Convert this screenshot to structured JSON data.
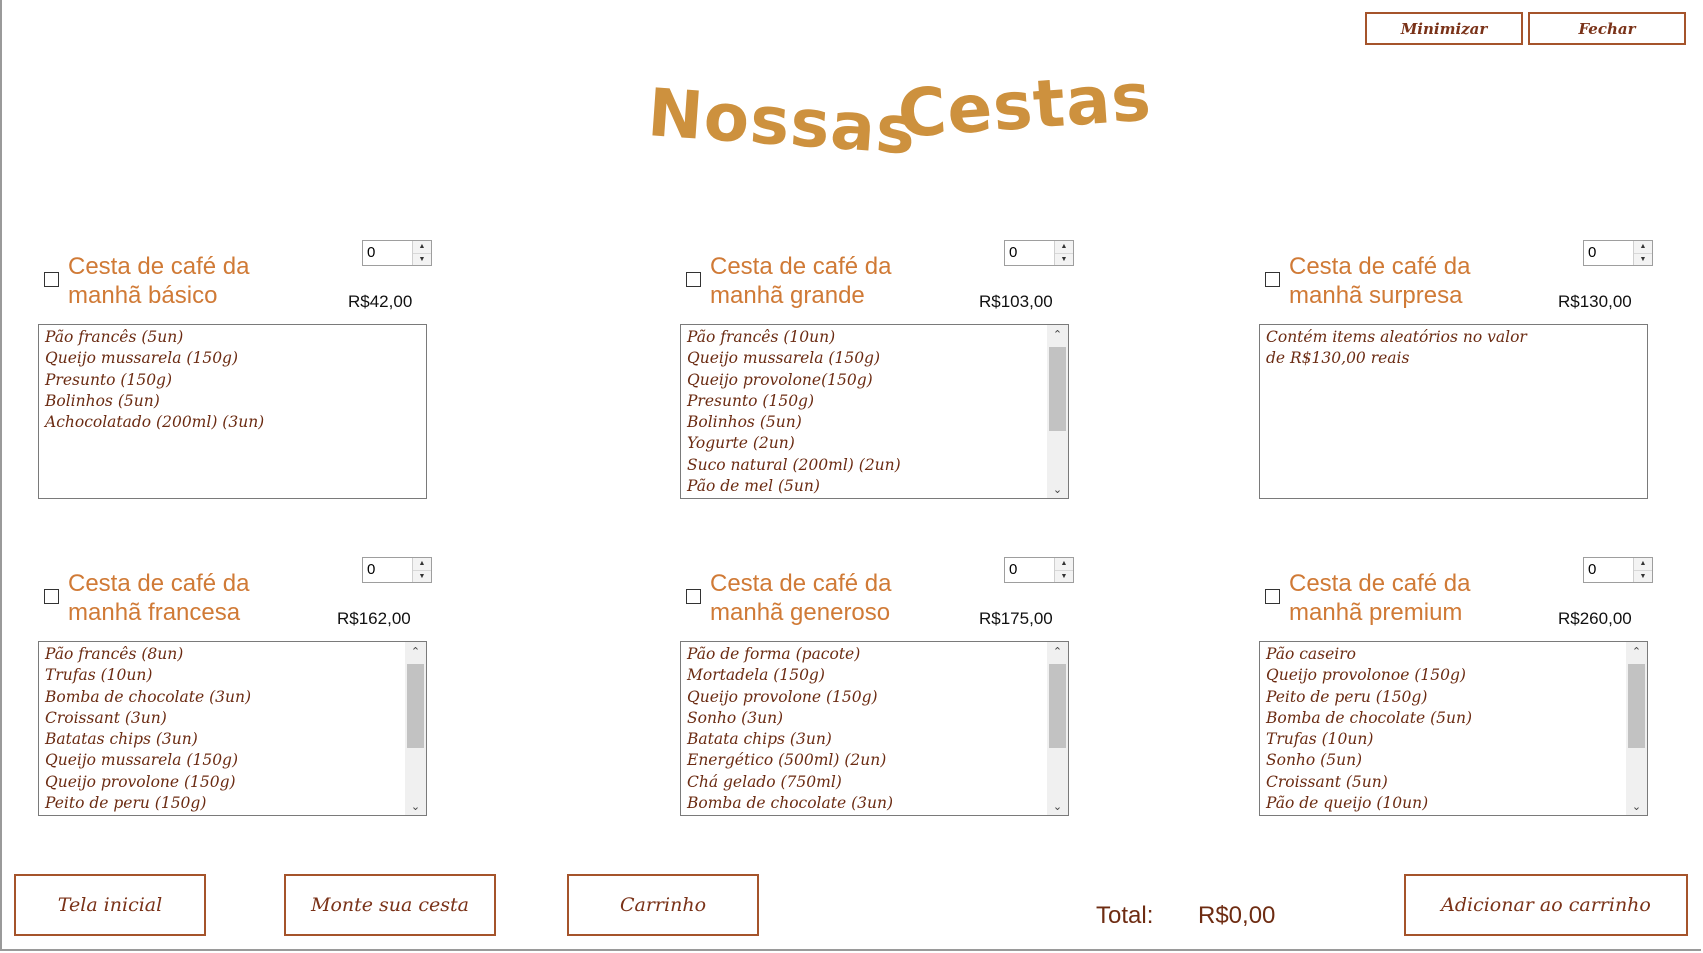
{
  "window": {
    "minimize_label": "Minimizar",
    "close_label": "Fechar"
  },
  "page": {
    "title_word1": "Nossas",
    "title_word2": "Cestas"
  },
  "baskets": [
    {
      "name": "Cesta de café da manhã básico",
      "price": "R$42,00",
      "quantity": "0",
      "checked": false,
      "scrollable": false,
      "items": [
        "Pão francês (5un)",
        "Queijo mussarela (150g)",
        "Presunto (150g)",
        "Bolinhos (5un)",
        "Achocolatado (200ml) (3un)"
      ]
    },
    {
      "name": "Cesta de café da manhã grande",
      "price": "R$103,00",
      "quantity": "0",
      "checked": false,
      "scrollable": true,
      "items": [
        "Pão francês (10un)",
        "Queijo mussarela (150g)",
        "Queijo provolone(150g)",
        "Presunto (150g)",
        "Bolinhos (5un)",
        "Yogurte (2un)",
        "Suco natural (200ml) (2un)",
        "Pão de mel (5un)"
      ]
    },
    {
      "name": "Cesta de café da manhã surpresa",
      "price": "R$130,00",
      "quantity": "0",
      "checked": false,
      "scrollable": false,
      "items": [
        "Contém items aleatórios no valor",
        "de R$130,00 reais"
      ]
    },
    {
      "name": "Cesta de café da manhã francesa",
      "price": "R$162,00",
      "quantity": "0",
      "checked": false,
      "scrollable": true,
      "items": [
        "Pão francês (8un)",
        "Trufas (10un)",
        "Bomba de chocolate (3un)",
        "Croissant (3un)",
        "Batatas chips (3un)",
        "Queijo mussarela (150g)",
        "Queijo provolone (150g)",
        "Peito de peru (150g)"
      ]
    },
    {
      "name": "Cesta de café da manhã generoso",
      "price": "R$175,00",
      "quantity": "0",
      "checked": false,
      "scrollable": true,
      "items": [
        "Pão de forma (pacote)",
        "Mortadela (150g)",
        "Queijo provolone (150g)",
        "Sonho (3un)",
        "Batata chips (3un)",
        "Energético (500ml) (2un)",
        "Chá gelado (750ml)",
        "Bomba de chocolate (3un)"
      ]
    },
    {
      "name": "Cesta de café da manhã premium",
      "price": "R$260,00",
      "quantity": "0",
      "checked": false,
      "scrollable": true,
      "items": [
        "Pão caseiro",
        "Queijo provolonoe (150g)",
        "Peito de peru (150g)",
        "Bomba de chocolate (5un)",
        "Trufas (10un)",
        "Sonho (5un)",
        "Croissant (5un)",
        "Pão de queijo (10un)"
      ]
    }
  ],
  "footer": {
    "home_label": "Tela inicial",
    "build_label": "Monte sua cesta",
    "cart_label": "Carrinho",
    "total_label": "Total:",
    "total_value": "R$0,00",
    "add_label": "Adicionar ao carrinho"
  },
  "colors": {
    "title": "#cd913e",
    "basket_name": "#d07a36",
    "item_text": "#6b2b12",
    "button_border": "#a5542b"
  }
}
